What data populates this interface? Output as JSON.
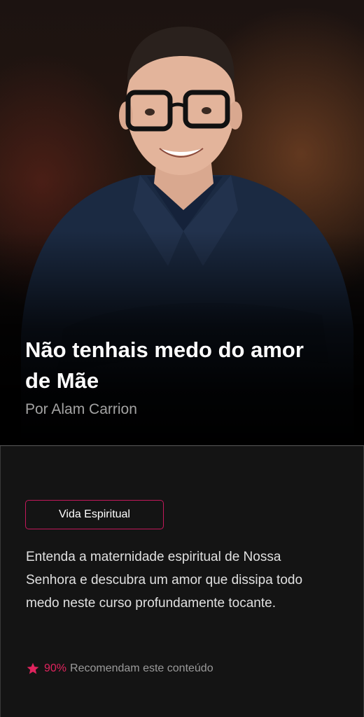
{
  "course": {
    "title": "Não tenhais medo do amor de Mãe",
    "author": "Por Alam Carrion",
    "category": "Vida Espiritual",
    "description": "Entenda a maternidade espiritual de Nossa Senhora e descubra um amor que dissipa todo medo neste curso profundamente tocante.",
    "rating_percent": "90%",
    "rating_text": "Recomendam este conteúdo"
  },
  "colors": {
    "accent": "#e0245e",
    "tag_border": "#c2185b",
    "background": "#141414",
    "shirt": "#1d2c44"
  },
  "icons": {
    "rating": "star-icon"
  }
}
